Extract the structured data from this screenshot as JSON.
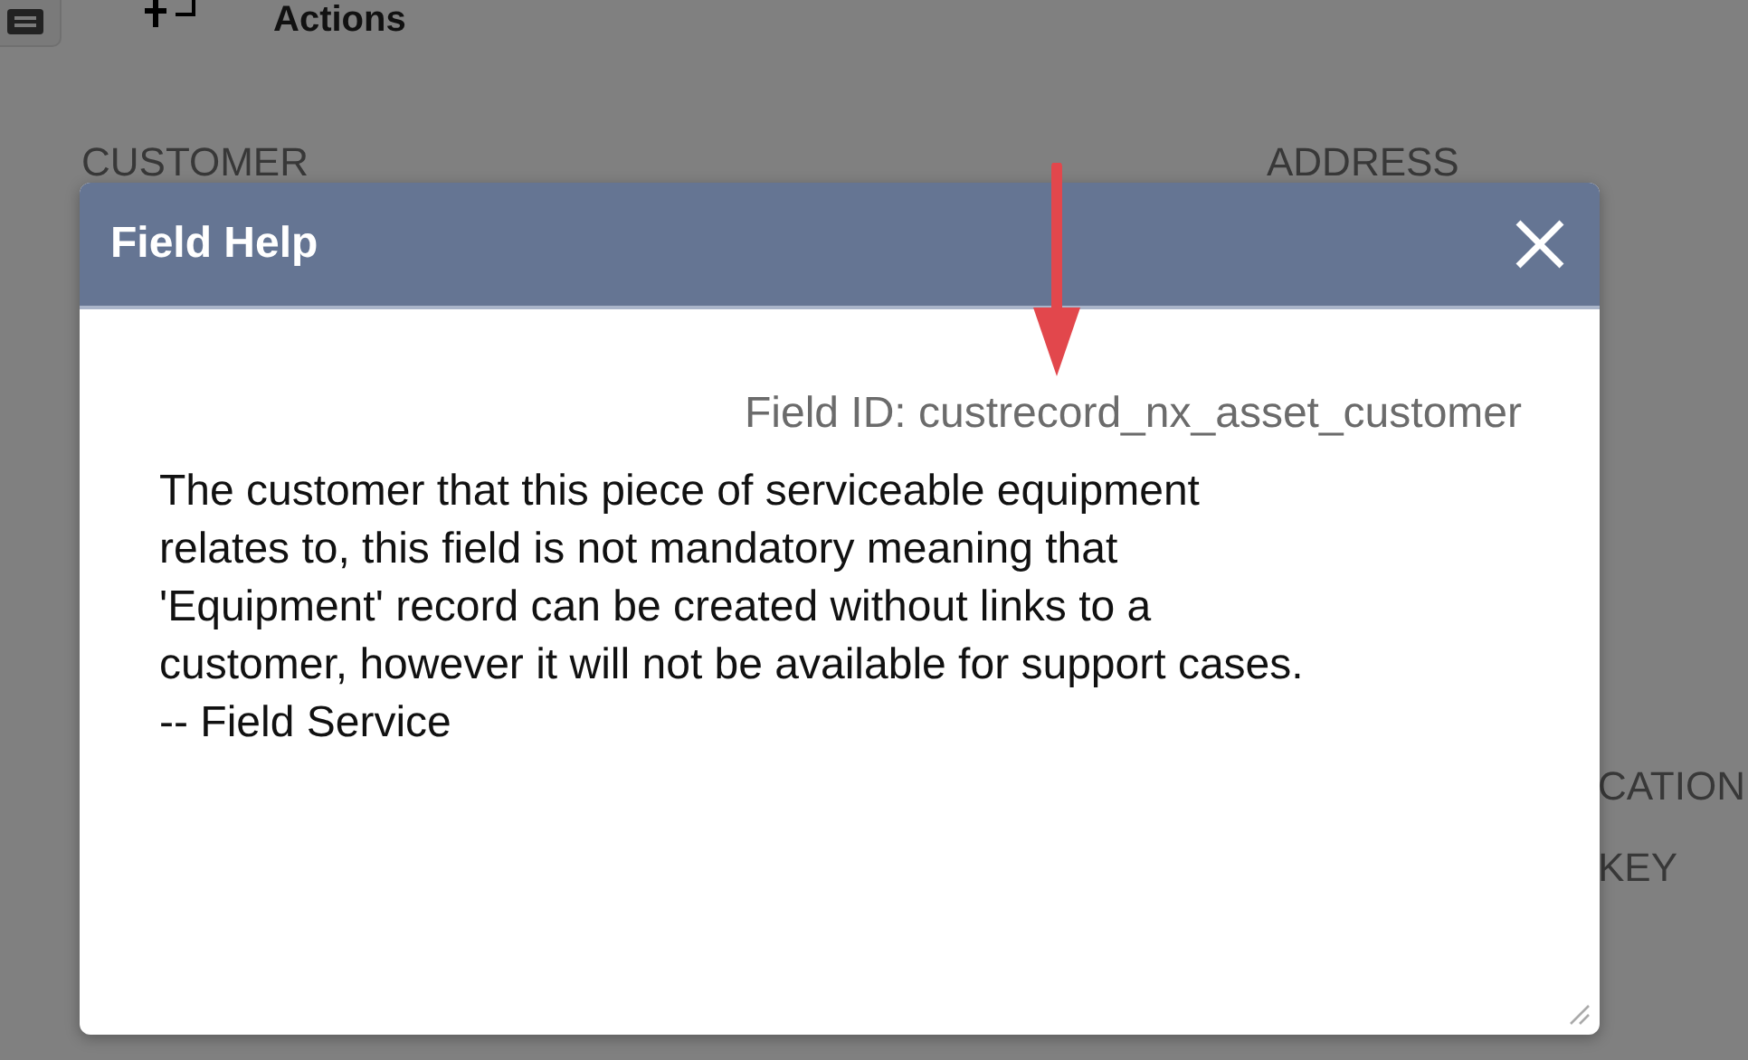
{
  "page": {
    "actions_label": "Actions",
    "labels": [
      {
        "text": "CUSTOMER",
        "kind": "left"
      },
      {
        "text": "ADDRESS",
        "kind": "right"
      },
      {
        "text": "CATION",
        "kind": "edge"
      },
      {
        "text": "KEY",
        "kind": "edge"
      }
    ]
  },
  "dialog": {
    "title": "Field Help",
    "field_id": "Field ID: custrecord_nx_asset_customer",
    "description_lines": [
      "The customer that this piece of serviceable equipment",
      "relates to, this field is not mandatory meaning that",
      "'Equipment' record can be created without links to a",
      "customer, however it will not be available for support cases.",
      "-- Field Service"
    ]
  }
}
